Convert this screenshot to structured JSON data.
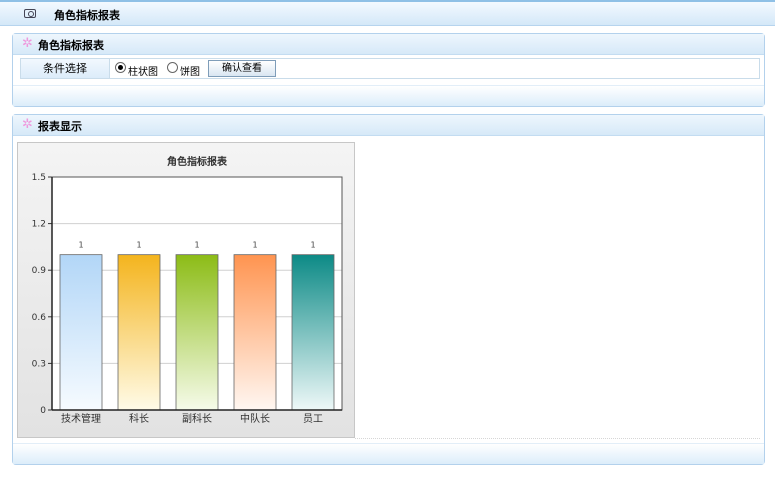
{
  "page": {
    "title": "角色指标报表"
  },
  "filter_panel": {
    "title": "角色指标报表",
    "condition_label": "条件选择",
    "options": [
      {
        "label": "柱状图",
        "selected": true
      },
      {
        "label": "饼图",
        "selected": false
      }
    ],
    "confirm_button": "确认查看"
  },
  "report_panel": {
    "title": "报表显示"
  },
  "chart_data": {
    "type": "bar",
    "title": "角色指标报表",
    "categories": [
      "技术管理",
      "科长",
      "副科长",
      "中队长",
      "员工"
    ],
    "values": [
      1,
      1,
      1,
      1,
      1
    ],
    "ylim": [
      0,
      1.5
    ],
    "yticks": [
      "0",
      "0.3",
      "0.6",
      "0.9",
      "1.2",
      "1.5"
    ],
    "grid": true,
    "colors": [
      [
        "#b2d6f7",
        "#f6fbff"
      ],
      [
        "#f4b41d",
        "#fffbe8"
      ],
      [
        "#8cbc16",
        "#f6fbea"
      ],
      [
        "#ff9450",
        "#fff7f2"
      ],
      [
        "#0c8a86",
        "#eef8f8"
      ]
    ]
  }
}
